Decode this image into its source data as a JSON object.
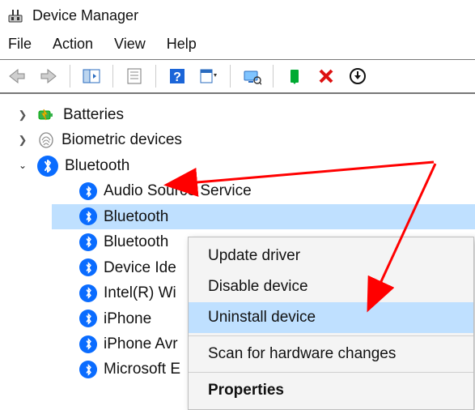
{
  "window": {
    "title": "Device Manager"
  },
  "menu": {
    "file": "File",
    "action": "Action",
    "view": "View",
    "help": "Help"
  },
  "tree": {
    "batteries": "Batteries",
    "biometric": "Biometric devices",
    "bluetooth": "Bluetooth",
    "bt_children": {
      "audio": "Audio Source Service",
      "selected": "Bluetooth ",
      "bt2": "Bluetooth ",
      "devid": "Device Ide",
      "intel": "Intel(R) Wi",
      "iphone": "iPhone",
      "iphoneavr": "iPhone Avr",
      "ms": "Microsoft E"
    }
  },
  "context": {
    "update": "Update driver",
    "disable": "Disable device",
    "uninstall": "Uninstall device",
    "scan": "Scan for hardware changes",
    "properties": "Properties"
  }
}
